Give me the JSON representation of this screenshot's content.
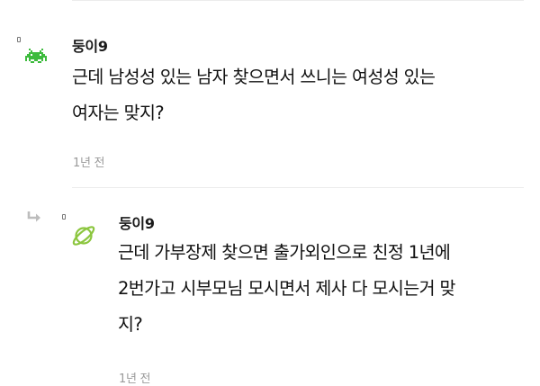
{
  "comments": [
    {
      "author": "둥이9",
      "avatar_icon": "space-invader-icon",
      "avatar_color": "#3dbb3d",
      "body": "근데 남성성 있는 남자 찾으면서 쓰니는 여성성 있는\n여자는 맞지?",
      "time": "1년 전"
    }
  ],
  "reply": {
    "reply_icon": "reply-arrow-icon",
    "author": "둥이9",
    "avatar_icon": "planet-icon",
    "avatar_color": "#8cc63f",
    "body": "근데 가부장제 찾으면 출가외인으로 친정 1년에\n2번가고 시부모님 모시면서 제사 다 모시는거 맞\n지?",
    "time": "1년 전"
  }
}
